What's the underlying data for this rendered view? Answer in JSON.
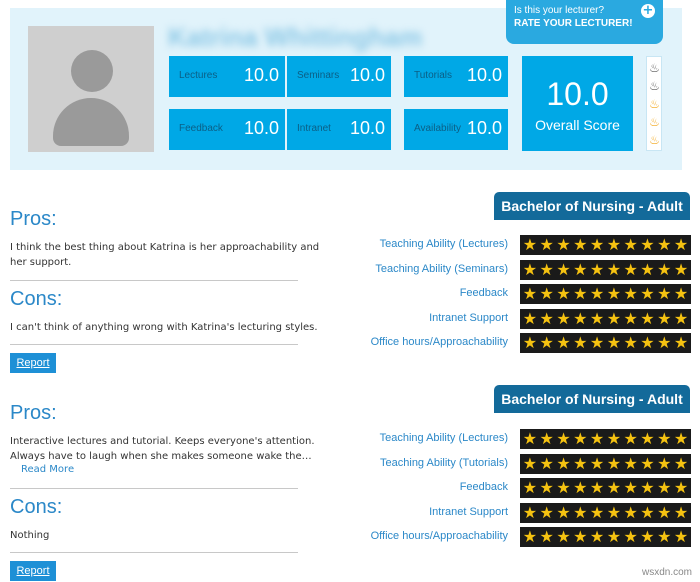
{
  "header": {
    "lecturer_name": "Katrina Whittingham",
    "cta_question": "Is this your lecturer?",
    "cta_action": "RATE YOUR LECTURER!",
    "cta_icon": "plus-icon",
    "scores": [
      {
        "label": "Lectures",
        "value": "10.0"
      },
      {
        "label": "Seminars",
        "value": "10.0"
      },
      {
        "label": "Tutorials",
        "value": "10.0"
      },
      {
        "label": "Feedback",
        "value": "10.0"
      },
      {
        "label": "Intranet",
        "value": "10.0"
      },
      {
        "label": "Availability",
        "value": "10.0"
      }
    ],
    "overall_value": "10.0",
    "overall_label": "Overall Score",
    "flame_meter": {
      "total": 5,
      "lit": 3,
      "lit_color": "#f2a516",
      "unlit_color": "#555555"
    }
  },
  "reviews": [
    {
      "pros_title": "Pros:",
      "pros_text_line1": "I think the best thing about Katrina is her approachability and",
      "pros_text_line2": "her support.",
      "cons_title": "Cons:",
      "cons_text": "I can't think of anything wrong with Katrina's lecturing styles.",
      "read_more": "",
      "report_label": "Report",
      "course": "Bachelor of Nursing - Adult",
      "ratings": [
        {
          "label": "Teaching Ability (Lectures)",
          "stars": 10
        },
        {
          "label": "Teaching Ability (Seminars)",
          "stars": 10
        },
        {
          "label": "Feedback",
          "stars": 10
        },
        {
          "label": "Intranet Support",
          "stars": 10
        },
        {
          "label": "Office hours/Approachability",
          "stars": 10
        }
      ]
    },
    {
      "pros_title": "Pros:",
      "pros_text_line1": "Interactive lectures and tutorial. Keeps everyone's attention.",
      "pros_text_line2": "Always have to laugh when she makes someone wake the…",
      "cons_title": "Cons:",
      "cons_text": "Nothing",
      "read_more": "Read More",
      "report_label": "Report",
      "course": "Bachelor of Nursing - Adult",
      "ratings": [
        {
          "label": "Teaching Ability (Lectures)",
          "stars": 10
        },
        {
          "label": "Teaching Ability (Tutorials)",
          "stars": 10
        },
        {
          "label": "Feedback",
          "stars": 10
        },
        {
          "label": "Intranet Support",
          "stars": 10
        },
        {
          "label": "Office hours/Approachability",
          "stars": 10
        }
      ]
    }
  ],
  "colors": {
    "accent": "#00a8e6",
    "heading_blue": "#2b88c8",
    "badge_blue": "#136a9a",
    "star_gold": "#f5c211"
  },
  "watermark": "wsxdn.com"
}
